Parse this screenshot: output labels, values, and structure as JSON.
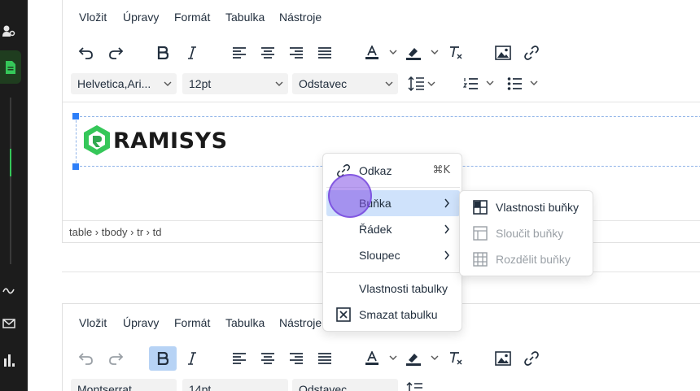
{
  "menubar": [
    "Vložit",
    "Úpravy",
    "Formát",
    "Tabulka",
    "Nástroje"
  ],
  "editor1": {
    "font_family": "Helvetica,Ari...",
    "font_size": "12pt",
    "block_format": "Odstavec",
    "statusbar_path": "table › tbody › tr › td",
    "logo_text": "RAMISYS"
  },
  "editor2": {
    "font_family": "Montserrat",
    "font_size": "14pt",
    "block_format": "Odstavec"
  },
  "context_menu": {
    "link": {
      "label": "Odkaz",
      "shortcut": "⌘K"
    },
    "cell": "Buňka",
    "row": "Řádek",
    "column": "Sloupec",
    "table_props": "Vlastnosti tabulky",
    "delete_table": "Smazat tabulku"
  },
  "submenu": {
    "cell_props": "Vlastnosti buňky",
    "merge_cells": "Sloučit buňky",
    "split_cell": "Rozdělit buňky"
  },
  "colors": {
    "accent_green": "#35c759",
    "highlight_blue": "#cfe2fb",
    "active_button": "#b7d3f5"
  }
}
